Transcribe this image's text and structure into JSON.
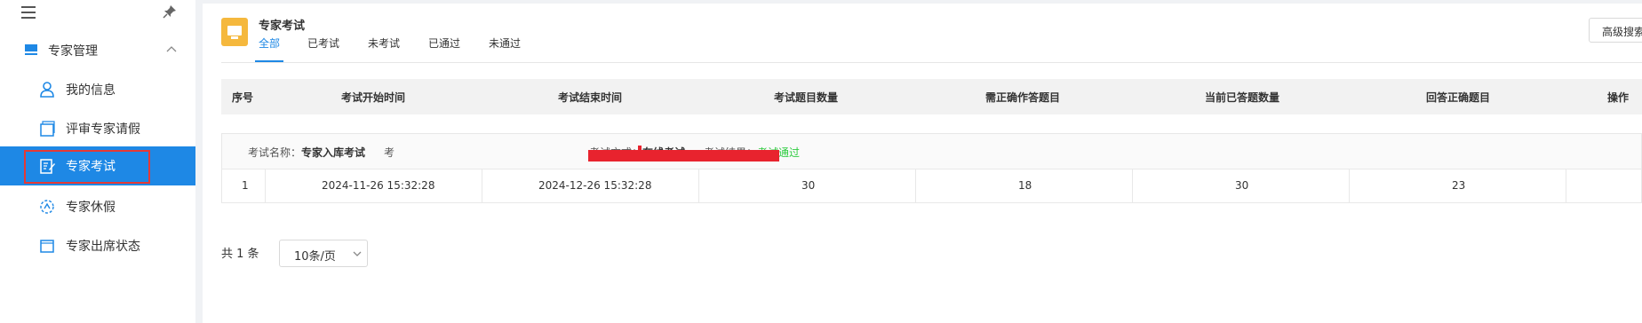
{
  "sidebar": {
    "group_label": "专家管理",
    "items": [
      {
        "label": "我的信息",
        "icon": "user-icon"
      },
      {
        "label": "评审专家请假",
        "icon": "cards-icon"
      },
      {
        "label": "专家考试",
        "icon": "edit-doc-icon",
        "active": true
      },
      {
        "label": "专家休假",
        "icon": "vacation-icon"
      },
      {
        "label": "专家出席状态",
        "icon": "folder-icon"
      }
    ]
  },
  "header": {
    "title": "专家考试",
    "tabs": [
      "全部",
      "已考试",
      "未考试",
      "已通过",
      "未通过"
    ],
    "active_tab": "全部",
    "advanced_search": "高级搜索"
  },
  "table": {
    "columns": [
      "序号",
      "考试开始时间",
      "考试结束时间",
      "考试题目数量",
      "需正确作答题目",
      "当前已答题数量",
      "回答正确题目",
      "操作"
    ],
    "group": {
      "exam_name_label": "考试名称：",
      "exam_name": "专家入库考试",
      "exam_number_prefix": "考",
      "method_label": "考试方式：",
      "method": "在线考试",
      "result_label": "考试结果：",
      "result": "考试通过"
    },
    "rows": [
      {
        "index": "1",
        "start": "2024-11-26 15:32:28",
        "end": "2024-12-26 15:32:28",
        "total": "30",
        "required": "18",
        "answered": "30",
        "correct": "23"
      }
    ]
  },
  "pagination": {
    "total_text": "共 1 条",
    "page_size": "10条/页"
  },
  "colors": {
    "accent": "#1e88e5",
    "highlight_outline": "#e53935",
    "pass": "#2ecc40",
    "title_icon_bg": "#f5b83d"
  }
}
